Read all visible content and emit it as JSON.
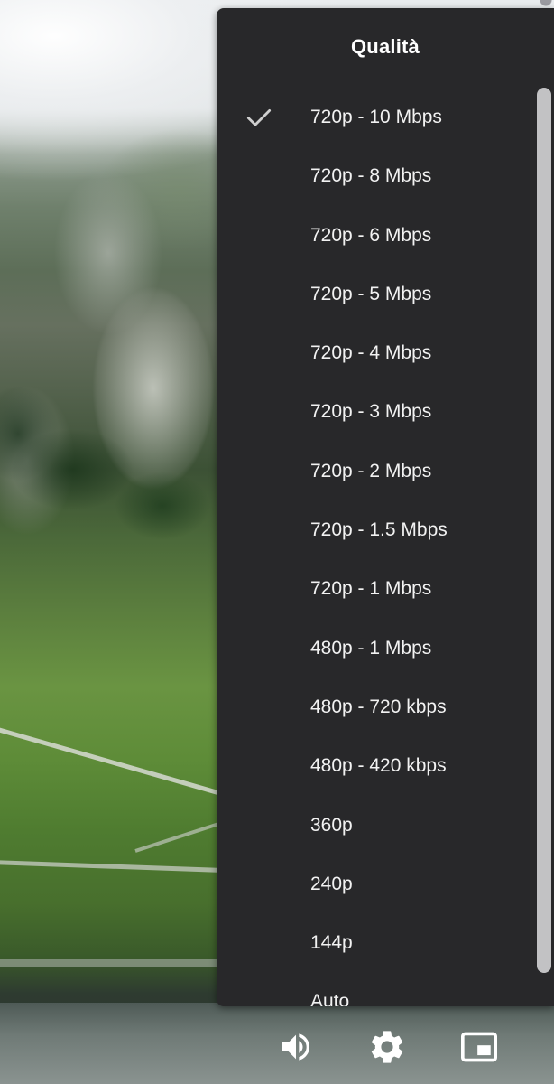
{
  "menu": {
    "title": "Qualità",
    "selected_index": 0,
    "items": [
      {
        "label": "720p - 10 Mbps",
        "selected": true
      },
      {
        "label": "720p - 8 Mbps",
        "selected": false
      },
      {
        "label": "720p - 6 Mbps",
        "selected": false
      },
      {
        "label": "720p - 5 Mbps",
        "selected": false
      },
      {
        "label": "720p - 4 Mbps",
        "selected": false
      },
      {
        "label": "720p - 3 Mbps",
        "selected": false
      },
      {
        "label": "720p - 2 Mbps",
        "selected": false
      },
      {
        "label": "720p - 1.5 Mbps",
        "selected": false
      },
      {
        "label": "720p - 1 Mbps",
        "selected": false
      },
      {
        "label": "480p - 1 Mbps",
        "selected": false
      },
      {
        "label": "480p - 720 kbps",
        "selected": false
      },
      {
        "label": "480p - 420 kbps",
        "selected": false
      },
      {
        "label": "360p",
        "selected": false
      },
      {
        "label": "240p",
        "selected": false
      },
      {
        "label": "144p",
        "selected": false
      },
      {
        "label": "Auto",
        "selected": false
      }
    ]
  },
  "controls": {
    "icons": [
      "volume-icon",
      "settings-gear-icon",
      "picture-in-picture-icon"
    ]
  },
  "colors": {
    "menu_background": "#28282a",
    "text": "#ffffff",
    "check": "#cfcfcf"
  }
}
